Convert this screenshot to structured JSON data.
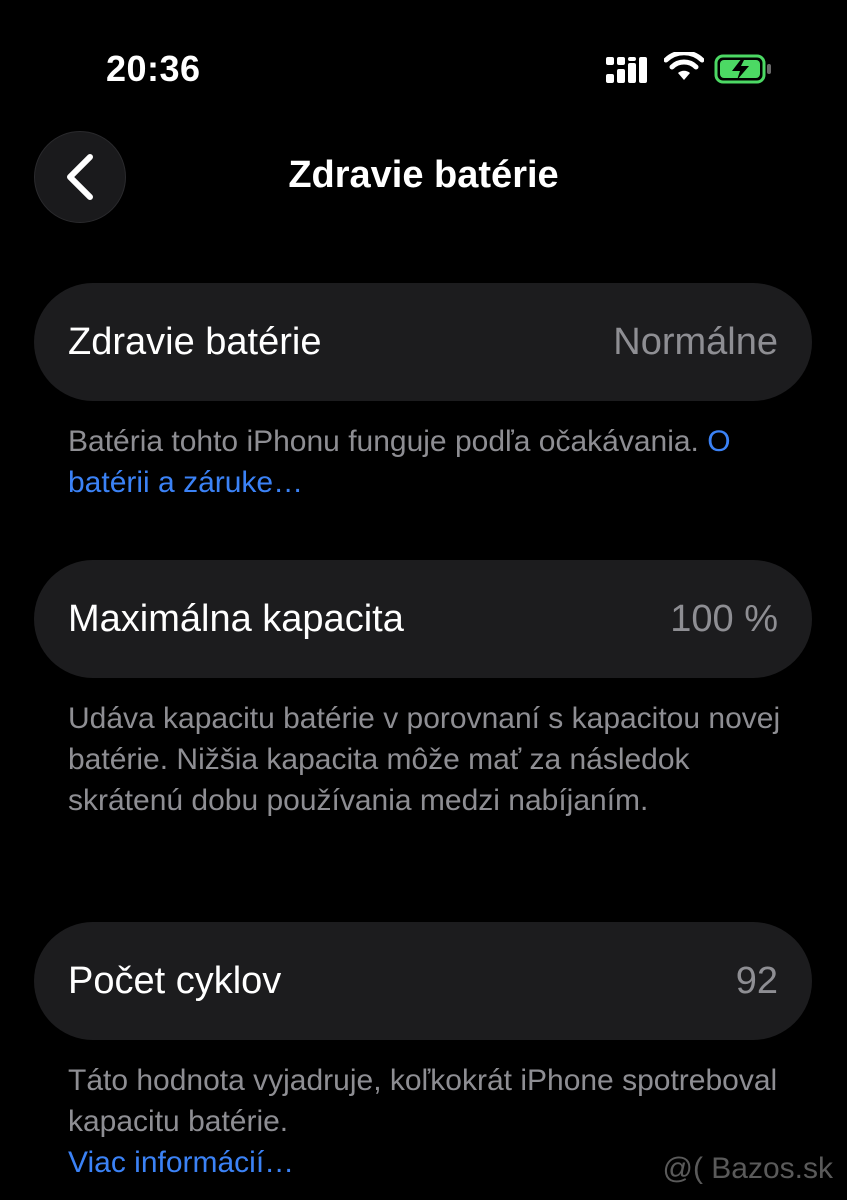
{
  "status_bar": {
    "time": "20:36",
    "icons": [
      "signal-icon",
      "wifi-icon",
      "battery-charging-icon"
    ],
    "battery_color": "#4cd964"
  },
  "nav": {
    "back_icon": "chevron-left-icon",
    "title": "Zdravie batérie"
  },
  "sections": {
    "health": {
      "label": "Zdravie batérie",
      "value": "Normálne",
      "footer_text": "Batéria tohto iPhonu funguje podľa očakávania. ",
      "footer_link": "O batérii a záruke…"
    },
    "capacity": {
      "label": "Maximálna kapacita",
      "value": "100 %",
      "footer_text": "Udáva kapacitu batérie v porovnaní s kapacitou novej batérie. Nižšia kapacita môže mať za následok skrátenú dobu používania medzi nabíjaním."
    },
    "cycles": {
      "label": "Počet cyklov",
      "value": "92",
      "footer_text": "Táto hodnota vyjadruje, koľkokrát iPhone spotreboval kapacitu batérie.",
      "footer_link": "Viac informácií…"
    }
  },
  "watermark": "@( Bazos.sk",
  "colors": {
    "background": "#000000",
    "cell_background": "#1c1c1e",
    "secondary_text": "#8e8e93",
    "link": "#3b82f6"
  }
}
